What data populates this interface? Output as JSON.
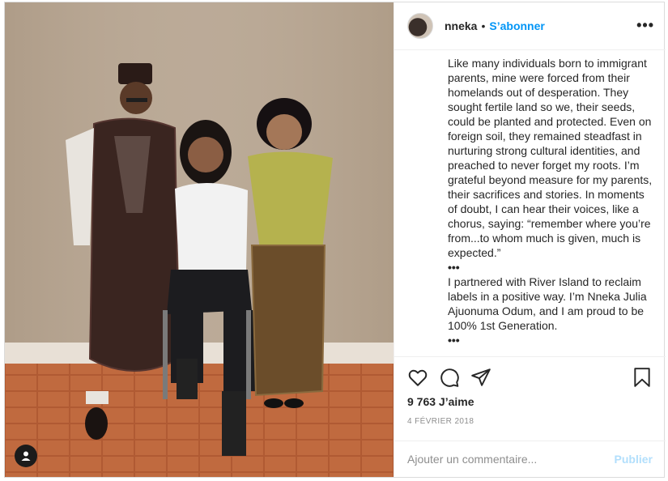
{
  "post": {
    "username": "nneka",
    "dot": "•",
    "follow_label": "S’abonner",
    "more_label": "•••"
  },
  "caption": {
    "paragraph1": "Like many individuals born to immigrant parents, mine were forced from their homelands out of desperation. They sought fertile land so we, their seeds, could be planted and protected. Even on foreign soil, they remained steadfast in nurturing strong cultural identities, and preached to never forget my roots. I’m grateful beyond measure for my parents, their sacrifices and stories. In moments of doubt, I can hear their voices, like a chorus, saying: “remember where you’re from...to whom much is given, much is expected.”",
    "separator1": "•••",
    "paragraph2": "I partnered with River Island to reclaim labels in a positive way. I’m Nneka Julia Ajuonuma Odum, and I am proud to be 100% 1st Generation.",
    "separator2": "•••"
  },
  "actions": {
    "icons": [
      "heart-icon",
      "comment-icon",
      "share-icon",
      "bookmark-icon"
    ],
    "likes": "9 763 J’aime",
    "date": "4 FÉVRIER 2018"
  },
  "comment": {
    "placeholder": "Ajouter un commentaire...",
    "publish_label": "Publier"
  },
  "colors": {
    "accent": "#0095f6",
    "publish_disabled": "#b2dffc",
    "text": "#262626",
    "muted": "#8e8e8e"
  }
}
